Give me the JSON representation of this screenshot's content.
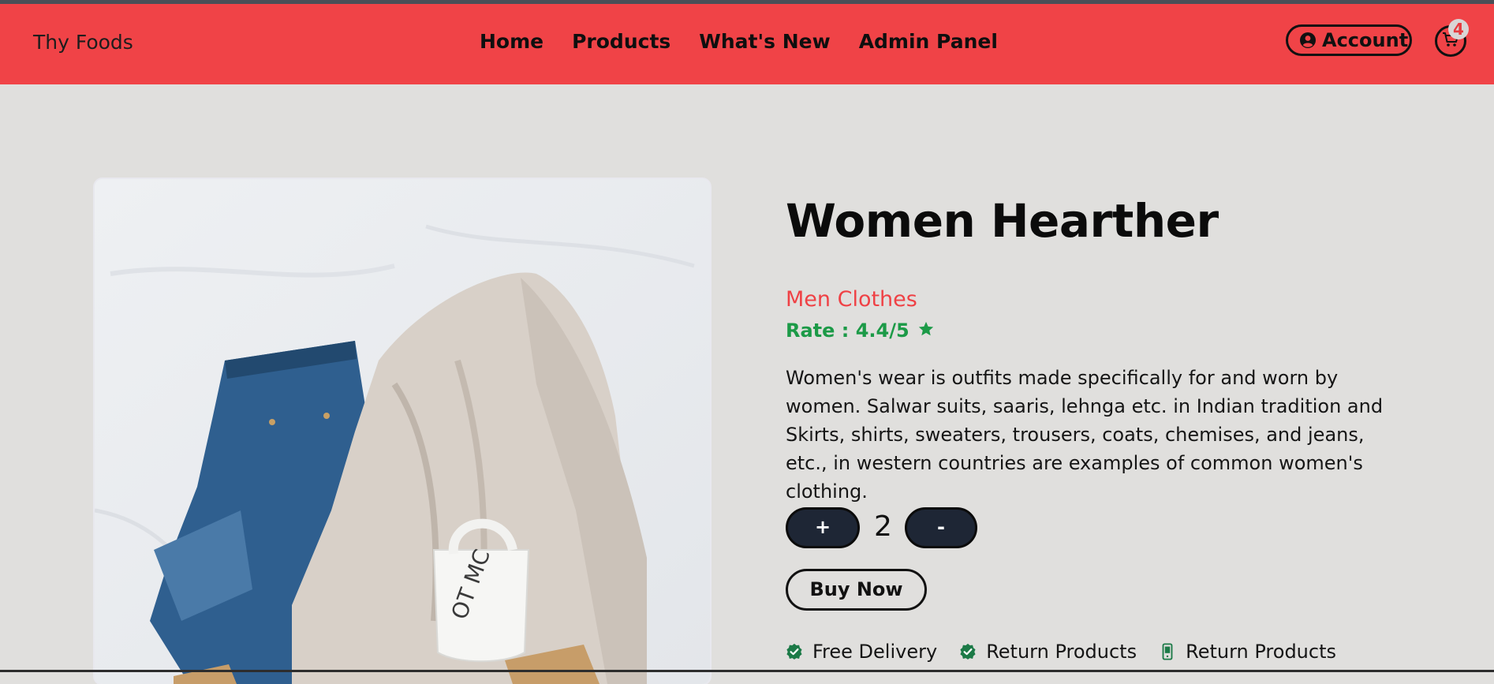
{
  "brand": "Thy Foods",
  "nav": {
    "links": [
      "Home",
      "Products",
      "What's New",
      "Admin Panel"
    ],
    "account_label": "Account",
    "cart_count": "4"
  },
  "product": {
    "title": "Women Hearther",
    "category": "Men Clothes",
    "rate": "Rate : 4.4/5",
    "description": "Women's wear is outfits made specifically for and worn by women. Salwar suits, saaris, lehnga etc. in Indian tradition and Skirts, shirts, sweaters, trousers, coats, chemises, and jeans, etc., in western countries are examples of common women's clothing.",
    "quantity": "2",
    "plus_label": "+",
    "minus_label": "-",
    "buy_label": "Buy Now",
    "image_name": "product-photo-jeans-sweater-mug"
  },
  "features": [
    {
      "label": "Free Delivery",
      "icon": "check-badge-icon"
    },
    {
      "label": "Return Products",
      "icon": "check-badge-icon"
    },
    {
      "label": "Return Products",
      "icon": "phone-icon"
    }
  ],
  "colors": {
    "navbar": "#f04347",
    "accent_red": "#ef4145",
    "rate_green": "#1c9a47",
    "button_dark": "#1e2635",
    "page_bg": "#e0dfdd"
  }
}
